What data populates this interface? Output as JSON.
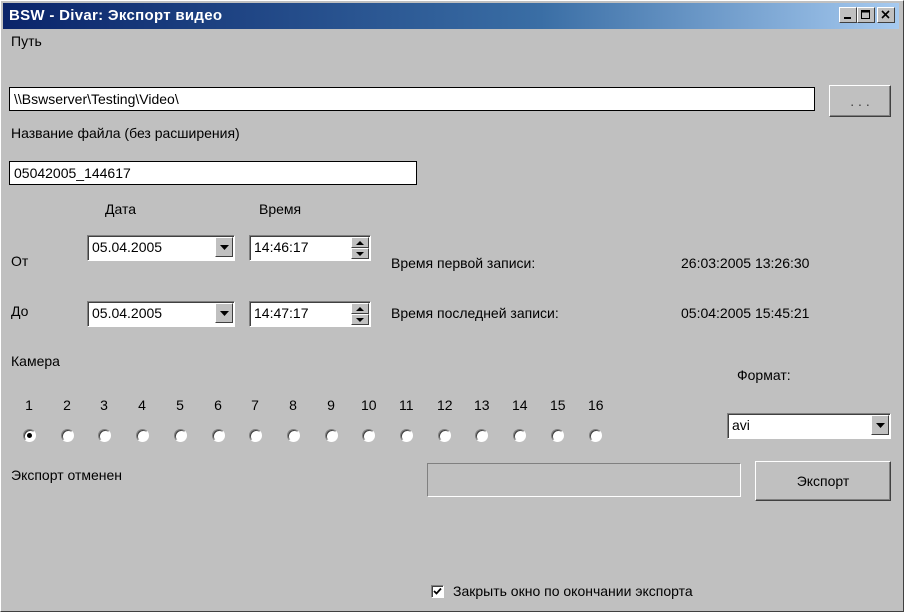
{
  "window": {
    "title": "BSW - Divar:  Экспорт  видео"
  },
  "path": {
    "label": "Путь",
    "value": "\\\\Bswserver\\Testing\\Video\\",
    "browse_label": ". . ."
  },
  "filename": {
    "label": "Название файла (без расширения)",
    "value": "05042005_144617"
  },
  "columns": {
    "date": "Дата",
    "time": "Время"
  },
  "from": {
    "label": "От",
    "date": "05.04.2005",
    "time": "14:46:17",
    "info_label": "Время первой записи:",
    "info_value": "26:03:2005 13:26:30"
  },
  "to": {
    "label": "До",
    "date": "05.04.2005",
    "time": "14:47:17",
    "info_label": "Время последней записи:",
    "info_value": "05:04:2005 15:45:21"
  },
  "camera": {
    "label": "Камера",
    "numbers": [
      "1",
      "2",
      "3",
      "4",
      "5",
      "6",
      "7",
      "8",
      "9",
      "10",
      "11",
      "12",
      "13",
      "14",
      "15",
      "16"
    ],
    "selected": "1"
  },
  "format": {
    "label": "Формат:",
    "value": "avi"
  },
  "status": {
    "text": "Экспорт отменен",
    "progress": 0
  },
  "export_button": {
    "label": "Экспорт"
  },
  "close_checkbox": {
    "label": "Закрыть окно по окончании экспорта",
    "checked": true
  }
}
